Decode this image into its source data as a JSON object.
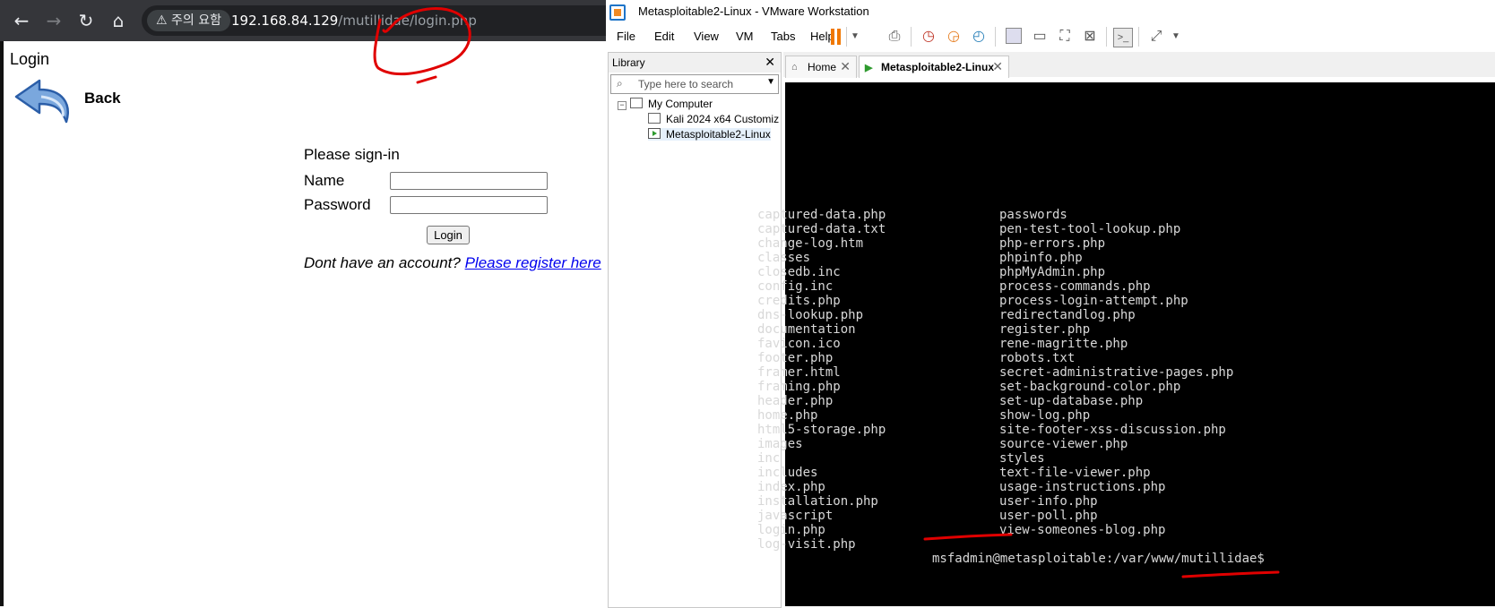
{
  "browser": {
    "warning": "⚠ 주의 요함",
    "url_host": "192.168.84.129",
    "url_path": "/mutillidae/login.php",
    "page_heading": "Login",
    "back_label": "Back",
    "form": {
      "title": "Please sign-in",
      "name_label": "Name",
      "password_label": "Password",
      "name_value": "",
      "password_value": "",
      "login_button": "Login",
      "register_prompt": "Dont have an account?",
      "register_link": "Please register here"
    }
  },
  "vmware": {
    "title": "Metasploitable2-Linux - VMware Workstation",
    "menu": [
      "File",
      "Edit",
      "View",
      "VM",
      "Tabs",
      "Help"
    ],
    "library": {
      "title": "Library",
      "search_placeholder": "Type here to search",
      "tree": {
        "root": "My Computer",
        "items": [
          "Kali 2024 x64 Customiz",
          "Metasploitable2-Linux"
        ]
      }
    },
    "tabs": [
      {
        "label": "Home"
      },
      {
        "label": "Metasploitable2-Linux"
      }
    ]
  },
  "terminal": {
    "left_column": [
      "captured-data.php",
      "captured-data.txt",
      "change-log.htm",
      "classes",
      "closedb.inc",
      "config.inc",
      "credits.php",
      "dns-lookup.php",
      "documentation",
      "favicon.ico",
      "footer.php",
      "framer.html",
      "framing.php",
      "header.php",
      "home.php",
      "html5-storage.php",
      "images",
      "inc",
      "includes",
      "index.php",
      "installation.php",
      "javascript",
      "login.php",
      "log-visit.php"
    ],
    "right_column": [
      "passwords",
      "pen-test-tool-lookup.php",
      "php-errors.php",
      "phpinfo.php",
      "phpMyAdmin.php",
      "process-commands.php",
      "process-login-attempt.php",
      "redirectandlog.php",
      "register.php",
      "rene-magritte.php",
      "robots.txt",
      "secret-administrative-pages.php",
      "set-background-color.php",
      "set-up-database.php",
      "show-log.php",
      "site-footer-xss-discussion.php",
      "source-viewer.php",
      "styles",
      "text-file-viewer.php",
      "usage-instructions.php",
      "user-info.php",
      "user-poll.php",
      "view-someones-blog.php"
    ],
    "prompt": "msfadmin@metasploitable:/var/www/mutillidae$"
  }
}
